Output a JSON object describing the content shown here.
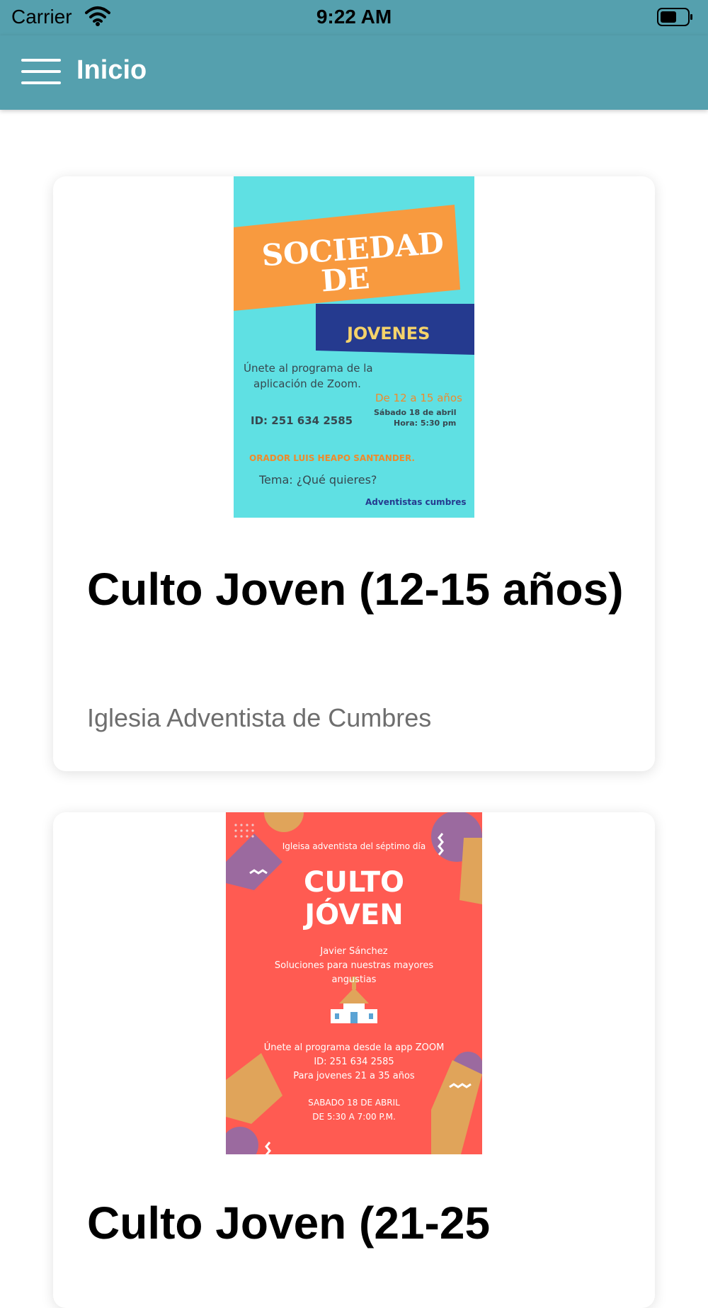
{
  "status_bar": {
    "carrier": "Carrier",
    "time": "9:22 AM",
    "icons": [
      "wifi-icon",
      "battery-icon"
    ]
  },
  "header": {
    "title": "Inicio",
    "menu_icon": "hamburger-menu-icon",
    "background": "#55a0ae"
  },
  "cards": [
    {
      "title": "Culto Joven (12-15 años)",
      "subtitle": "Iglesia Adventista de Cumbres",
      "poster": {
        "background": "#5fe0e3",
        "line1": "SOCIEDAD",
        "line2": "DE",
        "line3": "JOVENES",
        "invite1": "Únete al programa de la",
        "invite2": "aplicación de Zoom.",
        "ages": "De 12 a 15 años",
        "date": "Sábado 18 de abril",
        "hour": "Hora: 5:30 pm",
        "id": "ID: 251 634 2585",
        "speaker": "ORADOR LUIS HEAPO SANTANDER.",
        "theme": "Tema: ¿Qué quieres?",
        "footer": "Adventistas cumbres"
      }
    },
    {
      "title": "Culto Joven (21-25",
      "poster": {
        "background": "#ff5b52",
        "header": "Igleisa adventista del séptimo día",
        "line1": "CULTO",
        "line2": "JÓVEN",
        "speaker": "Javier Sánchez",
        "topic1": "Soluciones para nuestras mayores",
        "topic2": "angustias",
        "join": "Únete al programa desde la app ZOOM",
        "id": "ID: 251 634 2585",
        "ages": "Para jovenes 21 a 35 años",
        "date": "SABADO 18 DE ABRIL",
        "hours": "DE 5:30 A  7:00 P.M.",
        "icon": "church-icon"
      }
    }
  ]
}
